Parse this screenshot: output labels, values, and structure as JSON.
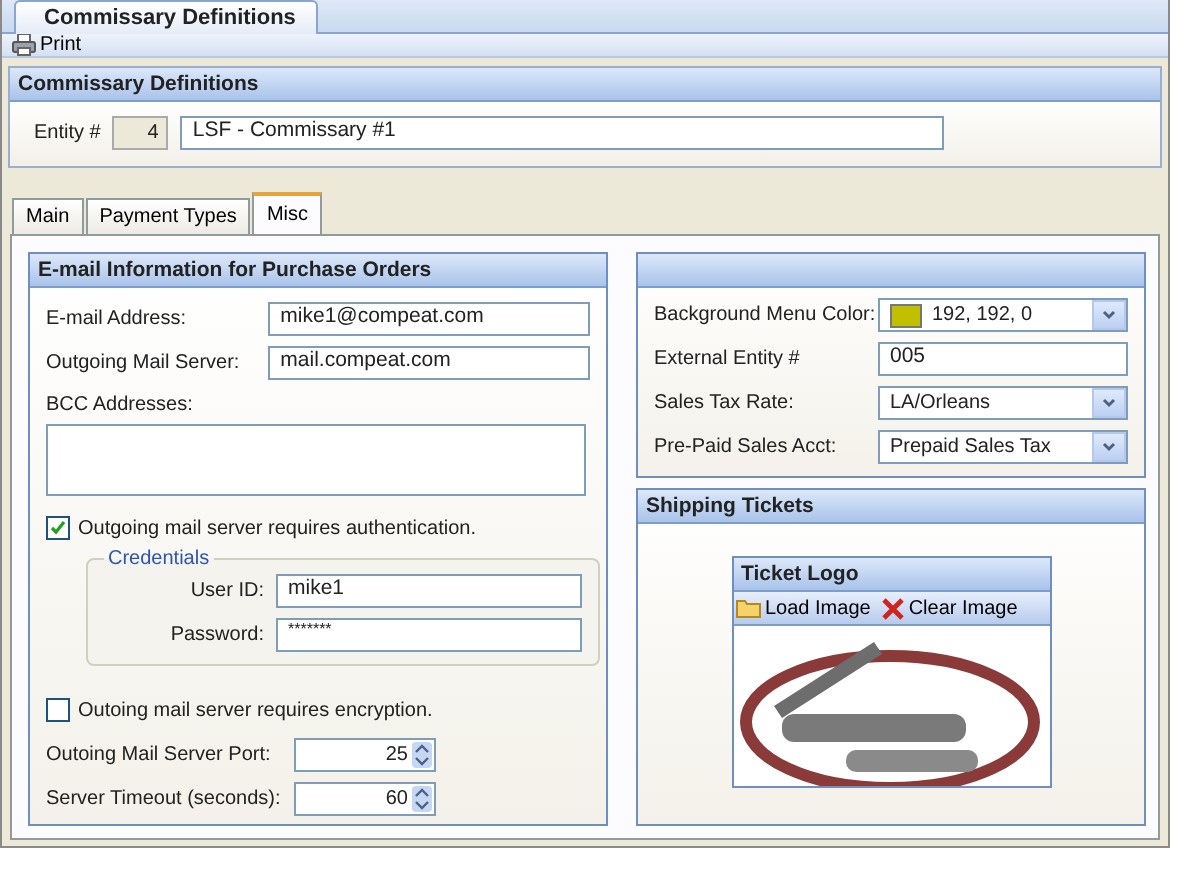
{
  "document_tab": {
    "label": "Commissary Definitions",
    "selected": true
  },
  "toolbar": {
    "print": "Print"
  },
  "header": {
    "title": "Commissary Definitions",
    "entity_label": "Entity #",
    "entity_number": "4",
    "entity_name": "LSF - Commissary #1"
  },
  "tabs": [
    {
      "label": "Main",
      "selected": false
    },
    {
      "label": "Payment Types",
      "selected": false
    },
    {
      "label": "Misc",
      "selected": true
    }
  ],
  "email_panel": {
    "title": "E-mail Information for Purchase Orders",
    "email_label": "E-mail Address:",
    "email": "mike1@compeat.com",
    "server_label": "Outgoing Mail Server:",
    "server": "mail.compeat.com",
    "bcc_label": "BCC Addresses:",
    "auth": {
      "label": "Outgoing mail server requires authentication.",
      "checked": true
    },
    "credentials": {
      "title": "Credentials",
      "user_label": "User ID:",
      "user": "mike1",
      "password_label": "Password:",
      "password": "*******"
    },
    "encryption": {
      "label": "Outoing mail server requires encryption.",
      "checked": false
    },
    "port_label": "Outoing Mail Server Port:",
    "port": "25",
    "timeout_label": "Server Timeout (seconds):",
    "timeout": "60"
  },
  "settings_panel": {
    "rows": [
      {
        "kind": "color",
        "label": "Background Menu Color:",
        "value": "192, 192, 0",
        "color": "#c0c000"
      },
      {
        "kind": "text",
        "label": "External Entity #",
        "value": "005"
      },
      {
        "kind": "dropdown",
        "label": "Sales Tax Rate:",
        "value": "LA/Orleans"
      },
      {
        "kind": "dropdown",
        "label": "Pre-Paid Sales Acct:",
        "value": "Prepaid Sales Tax"
      }
    ]
  },
  "shipping_panel": {
    "title": "Shipping Tickets",
    "logo_title": "Ticket Logo",
    "load": "Load Image",
    "clear": "Clear Image"
  }
}
